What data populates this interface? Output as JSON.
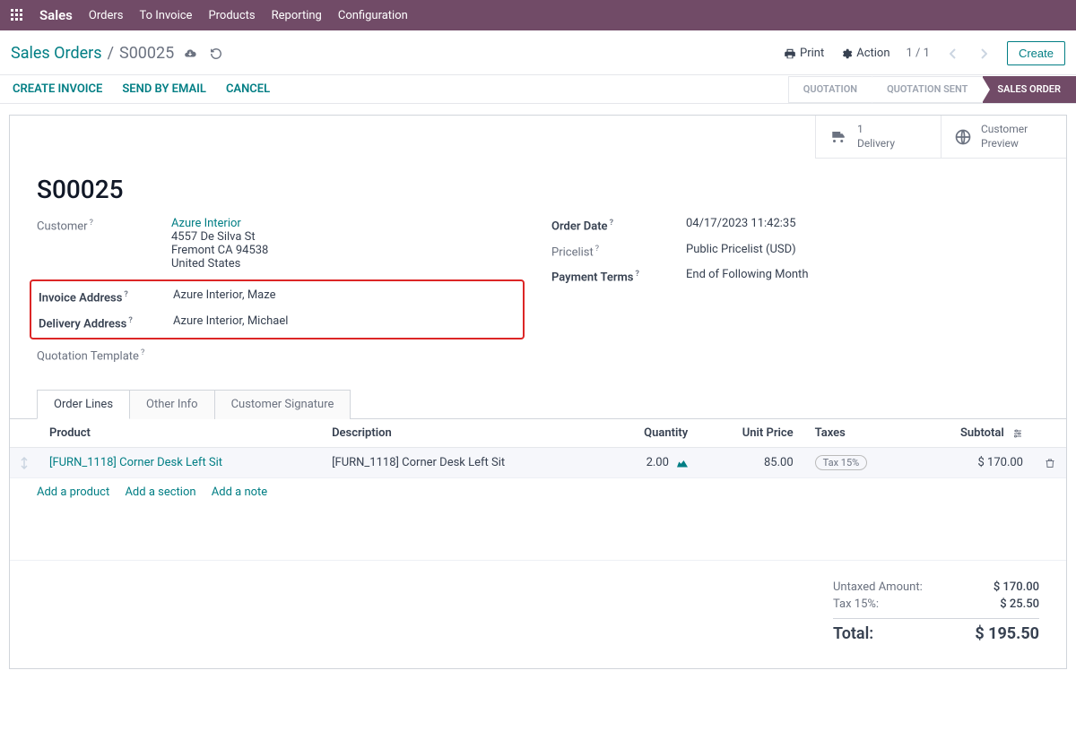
{
  "topnav": {
    "brand": "Sales",
    "items": [
      "Orders",
      "To Invoice",
      "Products",
      "Reporting",
      "Configuration"
    ]
  },
  "breadcrumb": {
    "root": "Sales Orders",
    "current": "S00025"
  },
  "toolbar": {
    "print": "Print",
    "action": "Action",
    "pager": "1 / 1",
    "create": "Create"
  },
  "action_buttons": [
    "CREATE INVOICE",
    "SEND BY EMAIL",
    "CANCEL"
  ],
  "status_steps": [
    {
      "label": "QUOTATION",
      "active": false
    },
    {
      "label": "QUOTATION SENT",
      "active": false
    },
    {
      "label": "SALES ORDER",
      "active": true
    }
  ],
  "stat_buttons": [
    {
      "icon": "truck",
      "line1": "1",
      "line2": "Delivery"
    },
    {
      "icon": "globe",
      "line1": "Customer",
      "line2": "Preview"
    }
  ],
  "doc": {
    "name": "S00025"
  },
  "fields_left": {
    "customer_label": "Customer",
    "customer_name": "Azure Interior",
    "customer_addr1": "4557 De Silva St",
    "customer_addr2": "Fremont CA 94538",
    "customer_country": "United States",
    "invoice_addr_label": "Invoice Address",
    "invoice_addr": "Azure Interior, Maze",
    "delivery_addr_label": "Delivery Address",
    "delivery_addr": "Azure Interior, Michael",
    "quotation_tmpl_label": "Quotation Template"
  },
  "fields_right": {
    "order_date_label": "Order Date",
    "order_date": "04/17/2023 11:42:35",
    "pricelist_label": "Pricelist",
    "pricelist": "Public Pricelist (USD)",
    "payment_terms_label": "Payment Terms",
    "payment_terms": "End of Following Month"
  },
  "tabs": [
    "Order Lines",
    "Other Info",
    "Customer Signature"
  ],
  "columns": {
    "product": "Product",
    "description": "Description",
    "quantity": "Quantity",
    "unit_price": "Unit Price",
    "taxes": "Taxes",
    "subtotal": "Subtotal"
  },
  "lines": [
    {
      "product": "[FURN_1118] Corner Desk Left Sit",
      "description": "[FURN_1118] Corner Desk Left Sit",
      "quantity": "2.00",
      "unit_price": "85.00",
      "taxes": "Tax 15%",
      "subtotal": "$ 170.00"
    }
  ],
  "add_links": {
    "product": "Add a product",
    "section": "Add a section",
    "note": "Add a note"
  },
  "totals": {
    "untaxed_label": "Untaxed Amount:",
    "untaxed_value": "$ 170.00",
    "tax_label": "Tax 15%:",
    "tax_value": "$ 25.50",
    "total_label": "Total:",
    "total_value": "$ 195.50"
  }
}
